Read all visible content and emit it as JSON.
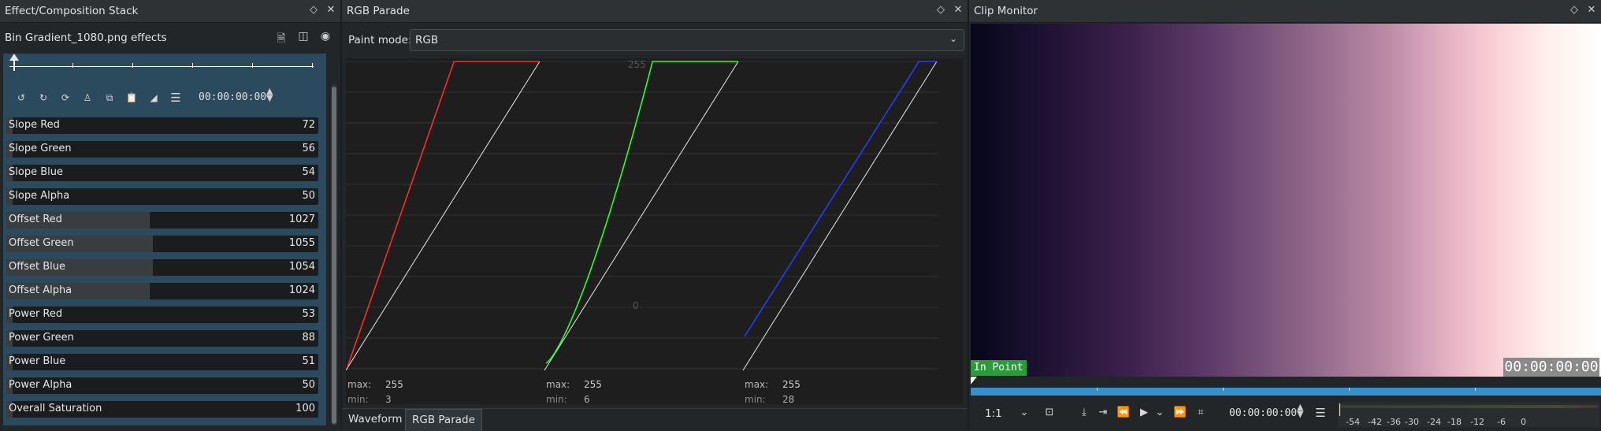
{
  "effects_panel": {
    "title": "Effect/Composition Stack",
    "clip_name": "Bin Gradient_1080.png effects",
    "timecode": "00:00:00:00",
    "params": [
      {
        "label": "Slope Red",
        "value": "72",
        "fill": 0.02
      },
      {
        "label": "Slope Green",
        "value": "56",
        "fill": 0.02
      },
      {
        "label": "Slope Blue",
        "value": "54",
        "fill": 0.02
      },
      {
        "label": "Slope Alpha",
        "value": "50",
        "fill": 0.02
      },
      {
        "label": "Offset Red",
        "value": "1027",
        "fill": 0.46
      },
      {
        "label": "Offset Green",
        "value": "1055",
        "fill": 0.47
      },
      {
        "label": "Offset Blue",
        "value": "1054",
        "fill": 0.47
      },
      {
        "label": "Offset Alpha",
        "value": "1024",
        "fill": 0.46
      },
      {
        "label": "Power Red",
        "value": "53",
        "fill": 0.02
      },
      {
        "label": "Power Green",
        "value": "88",
        "fill": 0.02
      },
      {
        "label": "Power Blue",
        "value": "51",
        "fill": 0.02
      },
      {
        "label": "Power Alpha",
        "value": "50",
        "fill": 0.02
      },
      {
        "label": "Overall Saturation",
        "value": "100",
        "fill": 0.02
      }
    ],
    "toolbar_icons": [
      "undo-keyframe-icon",
      "redo-icon",
      "sync-icon",
      "person-icon",
      "copy-icon",
      "paste-icon",
      "curve-icon",
      "menu-icon"
    ]
  },
  "parade_panel": {
    "title": "RGB Parade",
    "paint_mode_label": "Paint mode:",
    "paint_mode_value": "RGB",
    "scale_top": "255",
    "scale_bottom": "0",
    "channels": [
      {
        "color": "#ff2a2a",
        "max_label": "max:",
        "max": "255",
        "min_label": "min:",
        "min": "3"
      },
      {
        "color": "#2aff2a",
        "max_label": "max:",
        "max": "255",
        "min_label": "min:",
        "min": "6"
      },
      {
        "color": "#2a3aff",
        "max_label": "max:",
        "max": "255",
        "min_label": "min:",
        "min": "28"
      }
    ],
    "tabs": [
      "Waveform",
      "RGB Parade"
    ],
    "active_tab": "RGB Parade"
  },
  "monitor_panel": {
    "title": "Clip Monitor",
    "in_point": "In Point",
    "overlay_timecode": "00:00:00:00",
    "zoom": "1:1",
    "timecode": "00:00:00:00",
    "vu_labels": [
      "-54",
      "-42",
      "-36",
      "-30",
      "-24",
      "-18",
      "-12",
      "-6",
      "0"
    ]
  }
}
